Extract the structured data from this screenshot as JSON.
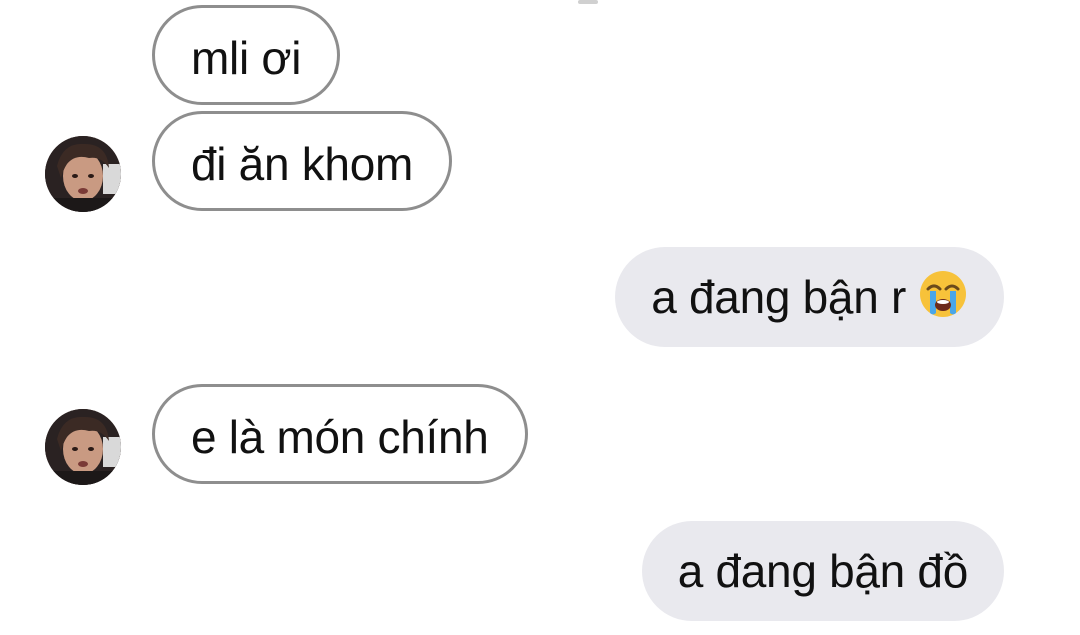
{
  "conversation": {
    "messages": [
      {
        "direction": "incoming",
        "text": "mli ơi",
        "has_avatar": false
      },
      {
        "direction": "incoming",
        "text": "đi ăn khom",
        "has_avatar": true
      },
      {
        "direction": "outgoing",
        "text": "a đang bận r",
        "emoji": "loudly-crying-face-emoji"
      },
      {
        "direction": "incoming",
        "text": "e là món chính",
        "has_avatar": true
      },
      {
        "direction": "outgoing",
        "text": "a đang bận đồ"
      }
    ]
  },
  "colors": {
    "incoming_border": "#8e8e8e",
    "incoming_bg": "#ffffff",
    "outgoing_bg": "#e9e9ee",
    "text": "#111111"
  }
}
